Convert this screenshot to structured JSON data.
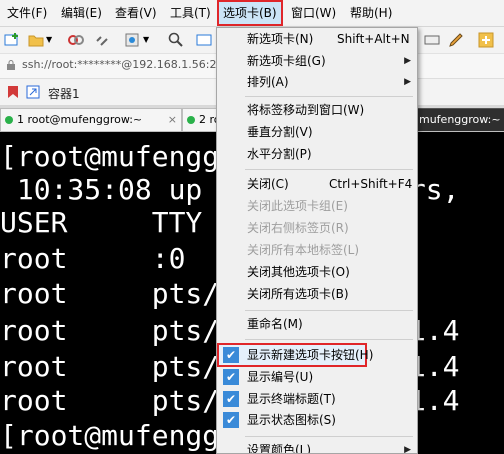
{
  "menubar": {
    "items": [
      "文件(F)",
      "编辑(E)",
      "查看(V)",
      "工具(T)",
      "选项卡(B)",
      "窗口(W)",
      "帮助(H)"
    ]
  },
  "address": {
    "text": "ssh://root:********@192.168.1.56:2"
  },
  "container": {
    "label": "容器1"
  },
  "tabs": {
    "tab1": "1 root@mufenggrow:~",
    "tab2": "2 ro",
    "tab_right": "mufenggrow:~",
    "close": "×"
  },
  "terminal": {
    "lines": [
      "[root@mufengg",
      " 10:35:08 up",
      "USER     TTY",
      "root     :0",
      "root     pts/(",
      "root     pts/",
      "root     pts/",
      "root     pts/",
      "[root@mufengg"
    ],
    "right": [
      "ers,",
      ".1.4",
      ".1.4",
      ".1.4"
    ]
  },
  "tab_menu": {
    "items": [
      {
        "label": "新选项卡(N)",
        "shortcut": "Shift+Alt+N"
      },
      {
        "label": "新选项卡组(G)",
        "arrow": "▶"
      },
      {
        "label": "排列(A)",
        "arrow": "▶"
      },
      {
        "label": "将标签移动到窗口(W)"
      },
      {
        "label": "垂直分割(V)"
      },
      {
        "label": "水平分割(P)"
      },
      {
        "label": "关闭(C)",
        "shortcut": "Ctrl+Shift+F4"
      },
      {
        "label": "关闭此选项卡组(E)"
      },
      {
        "label": "关闭右侧标签页(R)"
      },
      {
        "label": "关闭所有本地标签(L)"
      },
      {
        "label": "关闭其他选项卡(O)"
      },
      {
        "label": "关闭所有选项卡(B)"
      },
      {
        "label": "重命名(M)"
      },
      {
        "label": "显示新建选项卡按钮(H)",
        "checked": true
      },
      {
        "label": "显示编号(U)",
        "checked": true
      },
      {
        "label": "显示终端标题(T)",
        "checked": true
      },
      {
        "label": "显示状态图标(S)",
        "checked": true
      },
      {
        "label": "设置颜色(L)",
        "arrow": "▶"
      }
    ],
    "check_mark": "✔"
  },
  "colors": {
    "highlight_border": "#e0262a",
    "check_bg": "#3a8ad8",
    "menu_bg": "#f0f0f0"
  }
}
